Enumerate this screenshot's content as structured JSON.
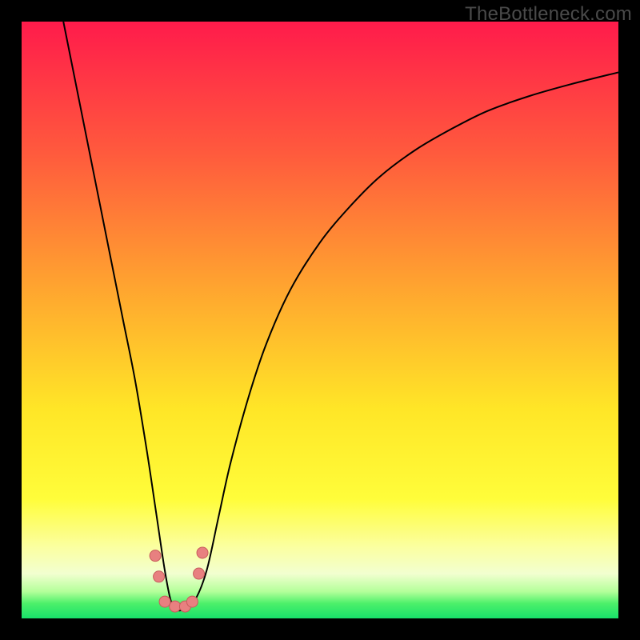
{
  "watermark": "TheBottleneck.com",
  "chart_data": {
    "type": "line",
    "title": "",
    "xlabel": "",
    "ylabel": "",
    "xlim": [
      0,
      100
    ],
    "ylim": [
      0,
      100
    ],
    "grid": false,
    "background": {
      "type": "linear-gradient-vertical",
      "stops": [
        {
          "offset": 0.0,
          "color": "#ff1b4b"
        },
        {
          "offset": 0.22,
          "color": "#ff5a3d"
        },
        {
          "offset": 0.45,
          "color": "#ffa62f"
        },
        {
          "offset": 0.65,
          "color": "#ffe627"
        },
        {
          "offset": 0.8,
          "color": "#fffd3a"
        },
        {
          "offset": 0.88,
          "color": "#fbffa0"
        },
        {
          "offset": 0.925,
          "color": "#f2ffd0"
        },
        {
          "offset": 0.955,
          "color": "#b4ff9a"
        },
        {
          "offset": 0.975,
          "color": "#4cf06a"
        },
        {
          "offset": 1.0,
          "color": "#18e06a"
        }
      ]
    },
    "series": [
      {
        "name": "bottleneck-curve",
        "stroke": "#000000",
        "stroke_width": 2,
        "x": [
          7,
          9,
          11,
          13,
          15,
          17,
          19,
          21,
          22.5,
          24,
          25,
          26,
          27,
          29,
          31,
          33,
          35,
          38,
          41,
          45,
          50,
          55,
          60,
          66,
          72,
          78,
          85,
          92,
          100
        ],
        "y": [
          100,
          90,
          80,
          70,
          60,
          50,
          40,
          28,
          18,
          8,
          3,
          1.5,
          1.5,
          3,
          8,
          17,
          26,
          37,
          46,
          55,
          63,
          69,
          74,
          78.5,
          82,
          85,
          87.5,
          89.5,
          91.5
        ]
      }
    ],
    "markers": [
      {
        "name": "valley-points",
        "shape": "circle",
        "fill": "#e88080",
        "stroke": "#c85c5c",
        "radius_px": 7,
        "points": [
          {
            "x": 22.4,
            "y": 10.5
          },
          {
            "x": 23.0,
            "y": 7.0
          },
          {
            "x": 24.0,
            "y": 2.8
          },
          {
            "x": 25.7,
            "y": 2.0
          },
          {
            "x": 27.4,
            "y": 2.0
          },
          {
            "x": 28.6,
            "y": 2.8
          },
          {
            "x": 29.7,
            "y": 7.5
          },
          {
            "x": 30.3,
            "y": 11.0
          }
        ]
      }
    ]
  }
}
